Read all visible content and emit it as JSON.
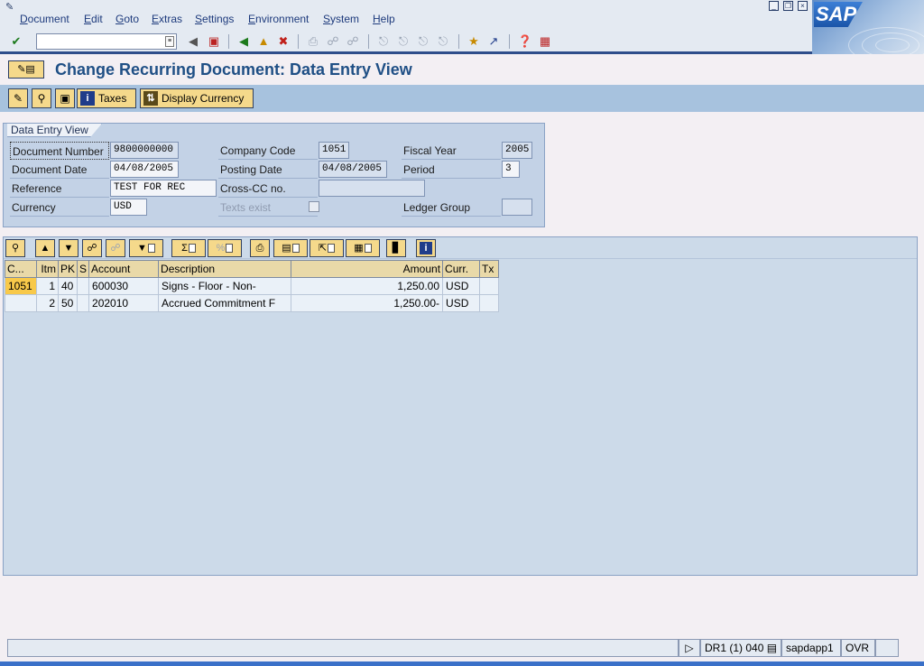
{
  "menu": {
    "items": [
      "Document",
      "Edit",
      "Goto",
      "Extras",
      "Settings",
      "Environment",
      "System",
      "Help"
    ]
  },
  "logo": {
    "text": "SAP"
  },
  "title": {
    "text": "Change Recurring Document: Data Entry View"
  },
  "app_toolbar": {
    "taxes_label": "Taxes",
    "display_currency_label": "Display Currency"
  },
  "header_panel": {
    "tab_label": "Data Entry View",
    "document_number": {
      "label": "Document Number",
      "value": "9800000000"
    },
    "document_date": {
      "label": "Document Date",
      "value": "04/08/2005"
    },
    "reference": {
      "label": "Reference",
      "value": "TEST FOR REC"
    },
    "currency": {
      "label": "Currency",
      "value": "USD"
    },
    "company_code": {
      "label": "Company Code",
      "value": "1051"
    },
    "posting_date": {
      "label": "Posting Date",
      "value": "04/08/2005"
    },
    "cross_cc": {
      "label": "Cross-CC no.",
      "value": ""
    },
    "texts_exist": {
      "label": "Texts exist"
    },
    "fiscal_year": {
      "label": "Fiscal Year",
      "value": "2005"
    },
    "period": {
      "label": "Period",
      "value": "3"
    },
    "ledger_group": {
      "label": "Ledger Group",
      "value": ""
    }
  },
  "grid": {
    "columns": [
      "C...",
      "Itm",
      "PK",
      "S",
      "Account",
      "Description",
      "Amount",
      "Curr.",
      "Tx"
    ],
    "rows": [
      {
        "cc": "1051",
        "itm": "1",
        "pk": "40",
        "s": "",
        "account": "600030",
        "description": "Signs - Floor - Non-",
        "amount": "1,250.00",
        "curr": "USD",
        "tx": ""
      },
      {
        "cc": "",
        "itm": "2",
        "pk": "50",
        "s": "",
        "account": "202010",
        "description": "Accrued Commitment F",
        "amount": "1,250.00-",
        "curr": "USD",
        "tx": ""
      }
    ]
  },
  "status_bar": {
    "system": "DR1 (1) 040",
    "server": "sapdapp1",
    "mode": "OVR"
  },
  "colors": {
    "title": "#1f4f85",
    "app_toolbar": "#a7c2de",
    "button": "#f5d98b",
    "highlight_cell": "#f8c94a"
  }
}
